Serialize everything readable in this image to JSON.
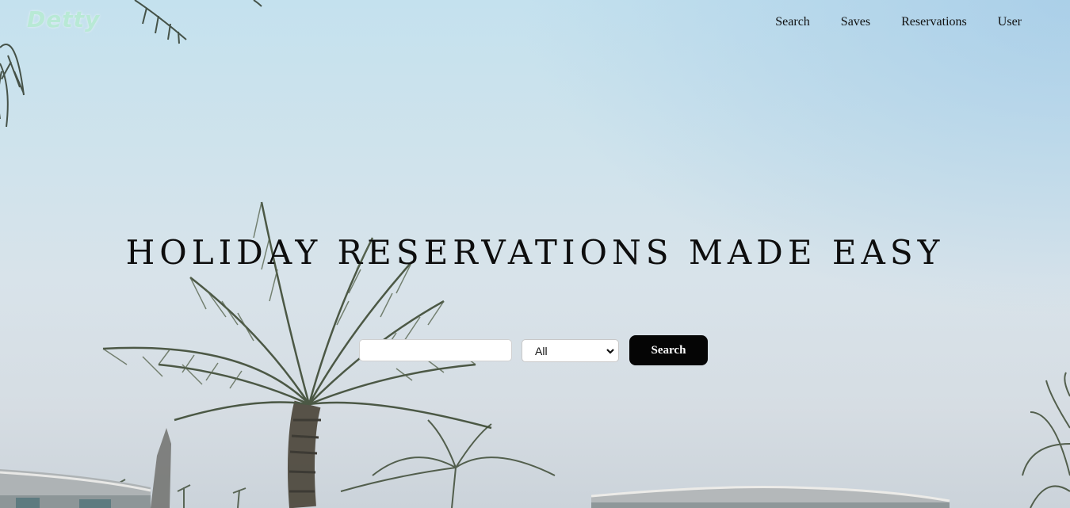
{
  "brand": {
    "logo_text": "Detty"
  },
  "nav": {
    "items": [
      {
        "label": "Search"
      },
      {
        "label": "Saves"
      },
      {
        "label": "Reservations"
      },
      {
        "label": "User"
      }
    ]
  },
  "hero": {
    "headline": "HOLIDAY RESERVATIONS MADE EASY"
  },
  "search": {
    "query_value": "",
    "category_selected": "All",
    "button_label": "Search"
  },
  "colors": {
    "logo": "#b8e9d5",
    "button_bg": "#050505",
    "button_text": "#ffffff"
  },
  "icons": {
    "select_arrow": "chevron-down-icon"
  }
}
